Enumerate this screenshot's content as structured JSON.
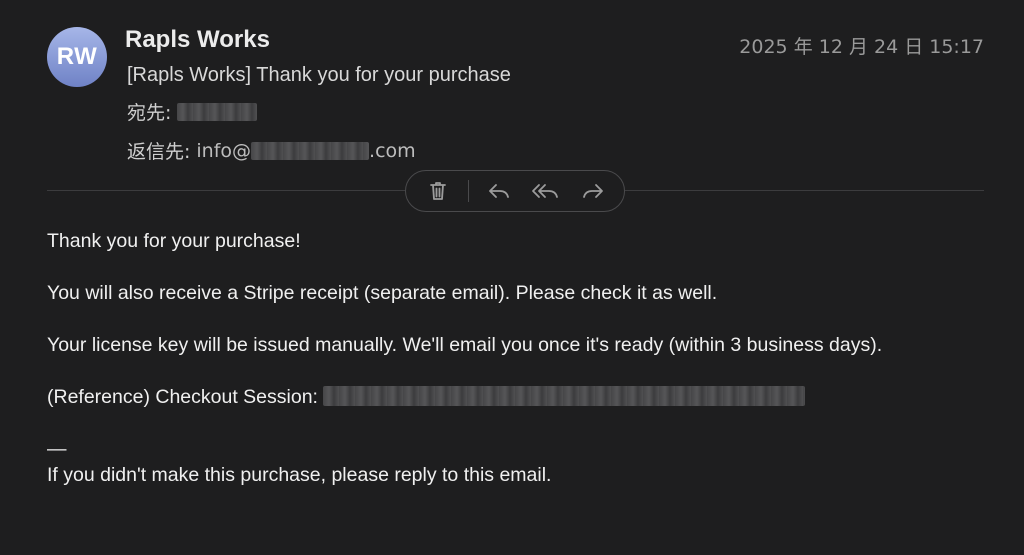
{
  "header": {
    "avatar_initials": "RW",
    "sender": "Rapls Works",
    "date": "2025 年 12 月 24 日 15:17",
    "subject": "[Rapls Works] Thank you for your purchase",
    "to_label": "宛先:",
    "replyto_label": "返信先:",
    "replyto_prefix": "info@",
    "replyto_suffix": ".com"
  },
  "toolbar": {
    "icons": [
      "trash-icon",
      "reply-icon",
      "reply-all-icon",
      "forward-icon"
    ]
  },
  "body": {
    "line1": "Thank you for your purchase!",
    "line2": "You will also receive a Stripe receipt (separate email). Please check it as well.",
    "line3": "Your license key will be issued manually. We'll email you once it's ready (within 3 business days).",
    "line4_prefix": "(Reference) Checkout Session: ",
    "dash": "—",
    "line5": "If you didn't make this purchase, please reply to this email."
  },
  "colors": {
    "background": "#1e1e1f",
    "avatar": "#8a9bd6"
  }
}
